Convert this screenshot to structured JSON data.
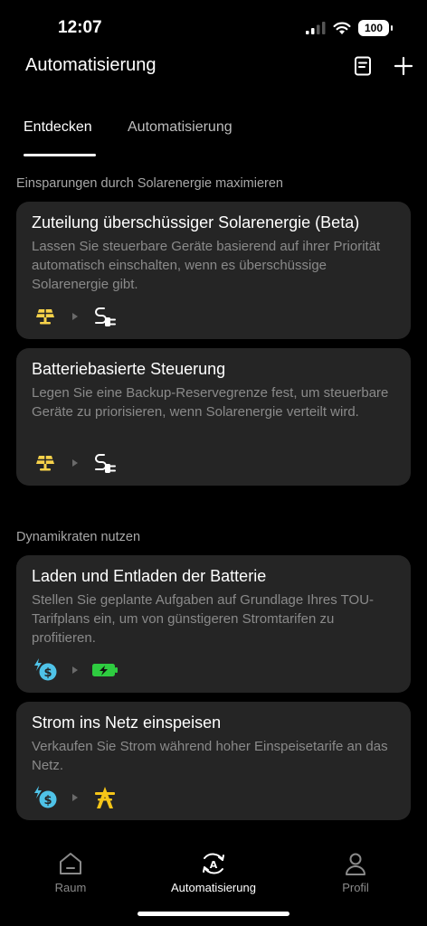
{
  "status_bar": {
    "time": "12:07",
    "battery": "100"
  },
  "header": {
    "title": "Automatisierung",
    "doc_icon": "document-icon",
    "add_icon": "plus-icon"
  },
  "tabs": [
    {
      "label": "Entdecken",
      "active": true
    },
    {
      "label": "Automatisierung",
      "active": false
    }
  ],
  "sections": [
    {
      "title": "Einsparungen durch Solarenergie maximieren",
      "cards": [
        {
          "title": "Zuteilung überschüssiger Solarenergie (Beta)",
          "description": "Lassen Sie steuerbare Geräte basierend auf ihrer Priorität automatisch einschalten, wenn es überschüssige Solarenergie gibt.",
          "icons": [
            "solar-panel-icon",
            "plug-icon"
          ]
        },
        {
          "title": "Batteriebasierte Steuerung",
          "description": "Legen Sie eine Backup-Reservegrenze fest, um steuerbare Geräte zu priorisieren, wenn Solarenergie verteilt wird.",
          "icons": [
            "solar-panel-icon",
            "plug-icon"
          ]
        }
      ]
    },
    {
      "title": "Dynamikraten nutzen",
      "cards": [
        {
          "title": "Laden und Entladen der Batterie",
          "description": "Stellen Sie geplante Aufgaben auf Grundlage Ihres TOU-Tarifplans ein, um von günstigeren Stromtarifen zu profitieren.",
          "icons": [
            "energy-price-icon",
            "battery-charging-icon"
          ]
        },
        {
          "title": "Strom ins Netz einspeisen",
          "description": "Verkaufen Sie Strom während hoher Einspeisetarife an das Netz.",
          "icons": [
            "energy-price-icon",
            "power-grid-icon"
          ]
        }
      ]
    }
  ],
  "bottom_nav": [
    {
      "label": "Raum",
      "icon": "home-icon",
      "active": false
    },
    {
      "label": "Automatisierung",
      "icon": "automation-icon",
      "active": true
    },
    {
      "label": "Profil",
      "icon": "profile-icon",
      "active": false
    }
  ],
  "colors": {
    "background": "#000000",
    "card": "#252525",
    "solar": "#F7D24A",
    "price": "#4FC3E8",
    "battery": "#2ECC40",
    "grid": "#F5C518"
  }
}
